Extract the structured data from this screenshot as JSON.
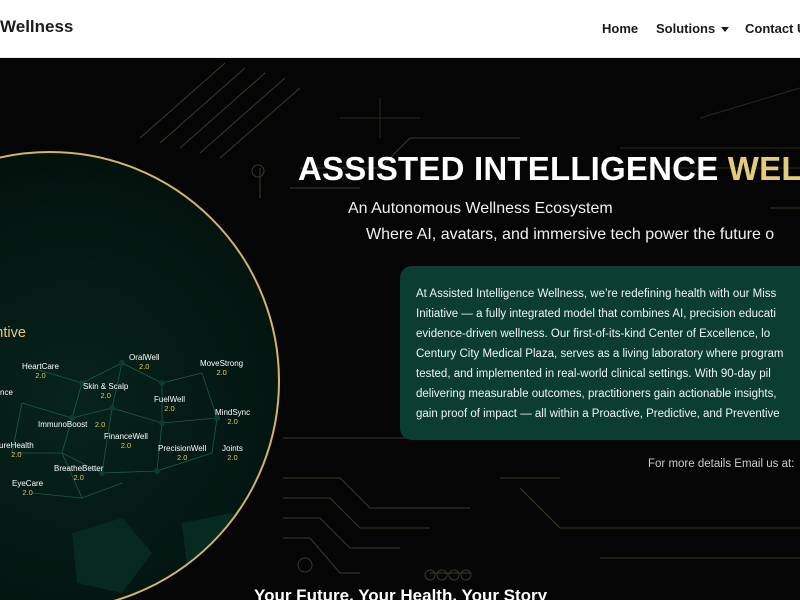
{
  "header": {
    "brand": "Wellness",
    "nav": {
      "home": "Home",
      "solutions": "Solutions",
      "contact": "Contact U"
    }
  },
  "hero": {
    "title_main": "ASSISTED INTELLIGENCE ",
    "title_accent": "WELL",
    "tagline_1": "An Autonomous Wellness Ecosystem",
    "tagline_2": "Where AI, avatars, and immersive tech power the future o",
    "circle": {
      "heading": "oactive, Predictive & Preventive",
      "version": "2.0",
      "nodes": [
        "HeartCare",
        "OralWell",
        "MoveStrong",
        "Skin & Scalp",
        "nce",
        "FuelWell",
        "ImmunoBoost",
        "MindSync",
        "FinanceWell",
        "ureHealth",
        "PrecisionWell",
        "Joints",
        "BreatheBetter",
        "EyeCare"
      ]
    },
    "info_lines": [
      "At Assisted Intelligence Wellness, we’re redefining health with our Miss",
      "Initiative — a fully integrated model that combines AI, precision educati",
      "evidence-driven wellness. Our first-of-its-kind Center of Excellence, lo",
      "Century City Medical Plaza, serves as a living laboratory where program",
      "tested, and implemented in real-world clinical settings. With 90-day pil",
      "delivering measurable outcomes, practitioners gain actionable insights,",
      "gain proof of impact — all within a Proactive, Predictive, and Preventive"
    ],
    "email_note": "For more details Email us at:",
    "bottom_heading": "Your Future. Your Health. Your Story"
  },
  "colors": {
    "accent_gold": "#e2cb79",
    "card_green": "#0c3d33",
    "background": "#050505"
  }
}
